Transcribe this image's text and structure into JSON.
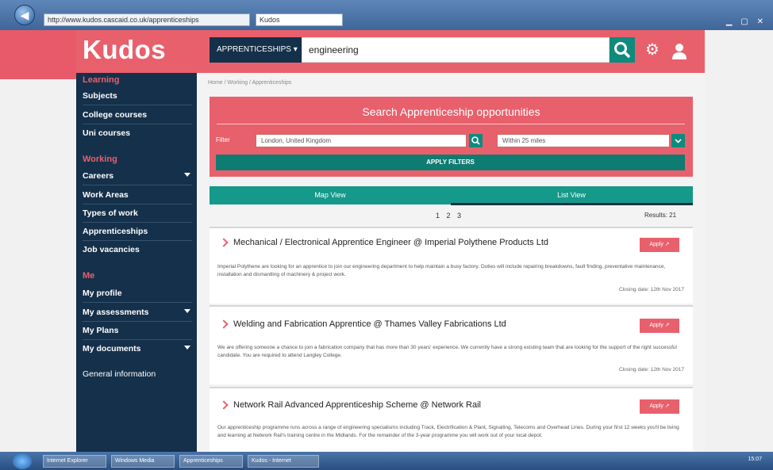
{
  "browser": {
    "address": "http://www.kudos.cascaid.co.uk/apprenticeships",
    "tab_title": "Kudos"
  },
  "header": {
    "logo": "Kudos",
    "search_type": "APPRENTICESHIPS ▾",
    "search_value": "engineering"
  },
  "sidebar": {
    "learning_heading": "Learning",
    "learning_items": [
      "Subjects",
      "College courses",
      "Uni courses"
    ],
    "working_heading": "Working",
    "working_items": [
      "Careers",
      "Work Areas",
      "Types of work",
      "Apprenticeships",
      "Job vacancies"
    ],
    "me_heading": "Me",
    "me_items": [
      "My profile",
      "My assessments",
      "My Plans",
      "My documents"
    ],
    "general": "General information"
  },
  "breadcrumb": "Home / Working / Apprenticeships",
  "search_panel": {
    "title": "Search Apprenticeship opportunities",
    "filter_label": "Filter",
    "location": "London, United Kingdom",
    "radius": "Within 25 miles",
    "apply_label": "APPLY FILTERS"
  },
  "tabs": {
    "map": "Map View",
    "list": "List View"
  },
  "pagination": "1 2 3",
  "results_label": "Results: 21",
  "apply_button_label": "Apply ↗",
  "listings": [
    {
      "title": "Mechanical / Electronical Apprentice Engineer @ Imperial Polythene Products Ltd",
      "desc": "Imperial Polythene are looking for an apprentice to join our engineering department to help maintain a busy factory. Duties will include repairing breakdowns, fault finding, preventative maintenance, installation and dismantling of machinery & project work.",
      "closing": "Closing date: 12th Nov 2017"
    },
    {
      "title": "Welding and Fabrication Apprentice @ Thames Valley Fabrications Ltd",
      "desc": "We are offering someone a chance to join a fabrication company that has more than 30 years' experience. We currently have a strong existing team that are looking for the support of the right successful candidate. You are required to attend Langley College.",
      "closing": "Closing date: 12th Nov 2017"
    },
    {
      "title": "Network Rail Advanced Apprenticeship Scheme @ Network Rail",
      "desc": "Our apprenticeship programme runs across a range of engineering specialisms including Track, Electrification & Plant, Signalling, Telecoms and Overhead Lines. During your first 12 weeks you'll be living and learning at Network Rail's training centre in the Midlands. For the remainder of the 3-year programme you will work out of your local depot."
    }
  ],
  "taskbar": {
    "items": [
      "Internet Explorer",
      "Windows Media",
      "Apprenticeships",
      "Kudos - Internet"
    ],
    "clock": "15:07"
  }
}
